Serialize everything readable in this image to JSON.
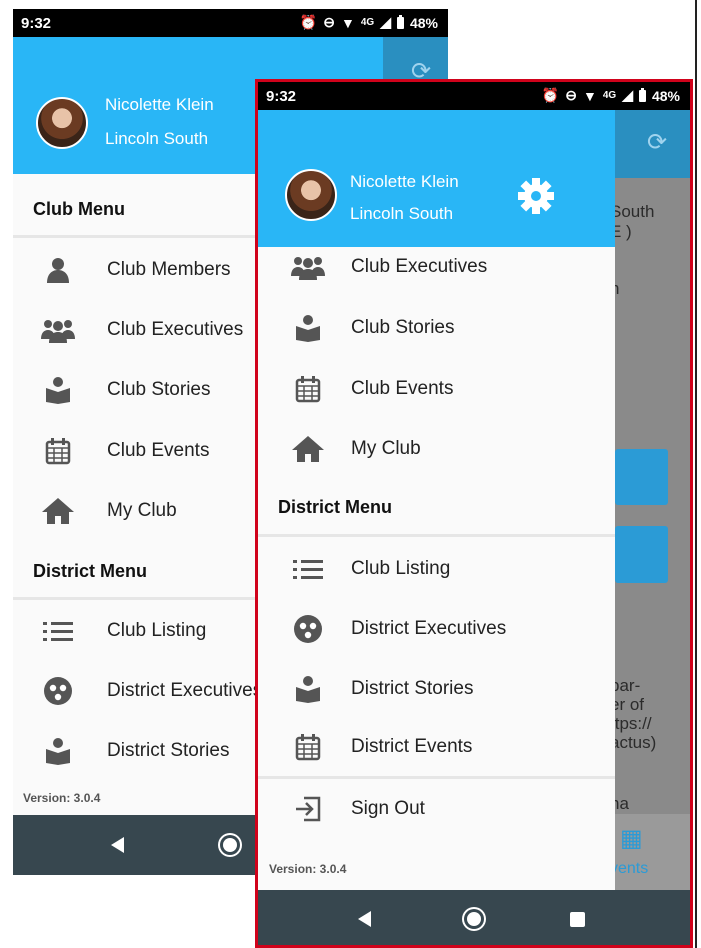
{
  "status": {
    "time": "9:32",
    "network": "4G",
    "battery": "48%"
  },
  "user": {
    "name": "Nicolette Klein",
    "club": "Lincoln South"
  },
  "drawer_back": {
    "club_menu_title": "Club Menu",
    "club_items": [
      {
        "label": "Club Members",
        "icon": "person-icon"
      },
      {
        "label": "Club Executives",
        "icon": "group-icon"
      },
      {
        "label": "Club Stories",
        "icon": "story-icon"
      },
      {
        "label": "Club Events",
        "icon": "calendar-icon"
      },
      {
        "label": "My Club",
        "icon": "home-icon"
      }
    ],
    "district_menu_title": "District Menu",
    "district_items": [
      {
        "label": "Club Listing",
        "icon": "list-icon"
      },
      {
        "label": "District Executives",
        "icon": "district-exec-icon"
      },
      {
        "label": "District Stories",
        "icon": "story-icon"
      }
    ],
    "version": "Version: 3.0.4"
  },
  "drawer_front": {
    "club_items": [
      {
        "label": "Club Executives",
        "icon": "group-icon"
      },
      {
        "label": "Club Stories",
        "icon": "story-icon"
      },
      {
        "label": "Club Events",
        "icon": "calendar-icon"
      },
      {
        "label": "My Club",
        "icon": "home-icon"
      }
    ],
    "district_menu_title": "District Menu",
    "district_items": [
      {
        "label": "Club Listing",
        "icon": "list-icon"
      },
      {
        "label": "District Executives",
        "icon": "district-exec-icon"
      },
      {
        "label": "District Stories",
        "icon": "story-icon"
      },
      {
        "label": "District Events",
        "icon": "calendar-icon"
      }
    ],
    "sign_out": "Sign Out",
    "version": "Version: 3.0.4"
  },
  "background_peek": {
    "lines": [
      "South",
      "E )",
      "n",
      "par-",
      "er of",
      "ttps://",
      "actus)",
      "na"
    ],
    "tab_label": "vents"
  },
  "colors": {
    "header": "#29b6f6",
    "navbar": "#37474f",
    "highlight_frame": "#d0021b",
    "icon": "#555555"
  }
}
